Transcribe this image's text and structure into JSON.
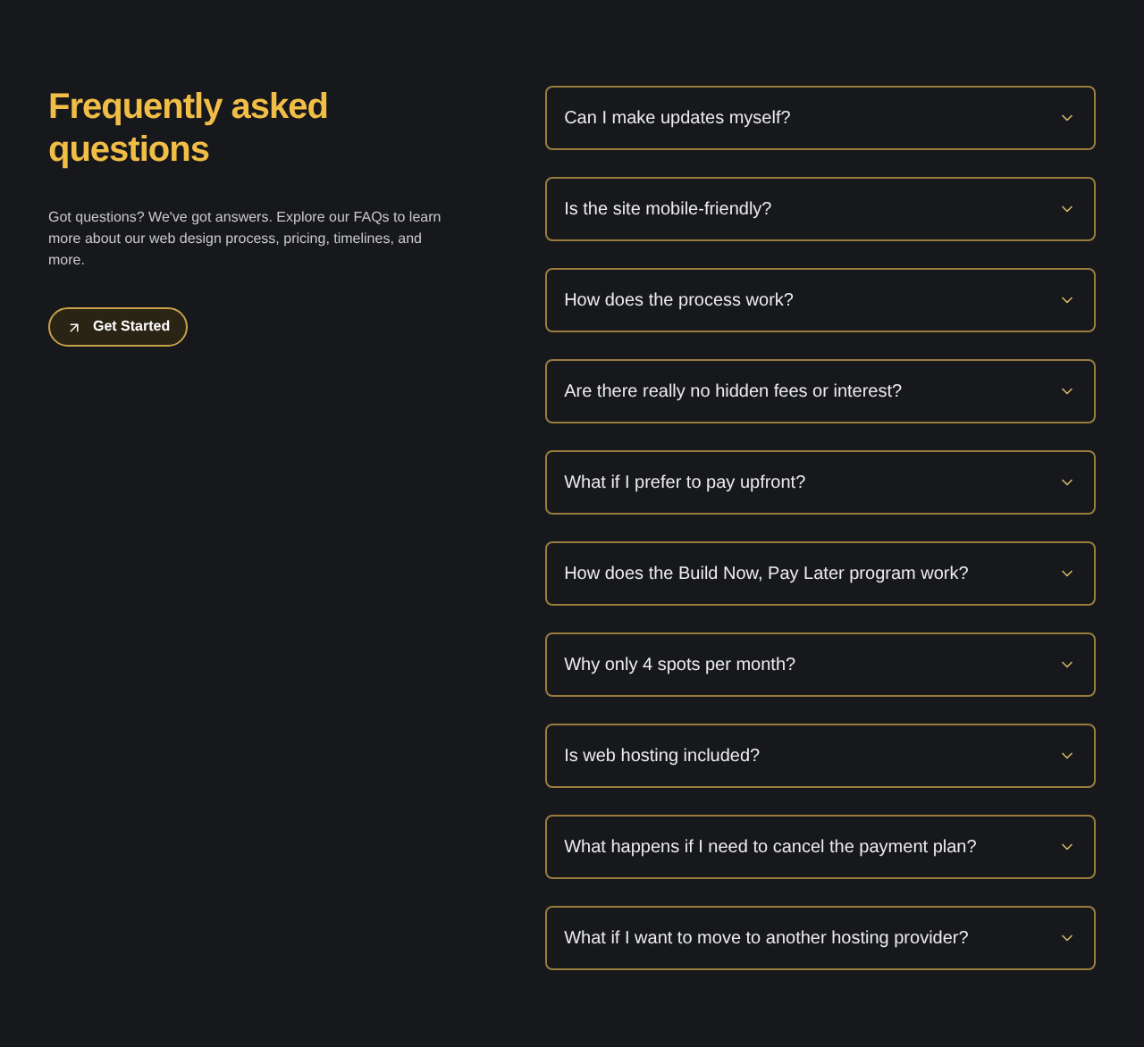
{
  "heading": "Frequently asked questions",
  "intro": "Got questions? We've got answers. Explore our FAQs to learn more about our web design process, pricing, timelines, and more.",
  "cta": {
    "label": "Get Started"
  },
  "faqs": [
    {
      "question": "Can I make updates myself?",
      "expanded": false
    },
    {
      "question": "Is the site mobile-friendly?",
      "expanded": false
    },
    {
      "question": "How does the process work?",
      "expanded": false
    },
    {
      "question": "Are there really no hidden fees or interest?",
      "expanded": false
    },
    {
      "question": "What if I prefer to pay upfront?",
      "expanded": false
    },
    {
      "question": "How does the Build Now, Pay Later program work?",
      "expanded": false
    },
    {
      "question": "Why only 4 spots per month?",
      "expanded": false
    },
    {
      "question": "Is web hosting included?",
      "expanded": false
    },
    {
      "question": "What happens if I need to cancel the payment plan?",
      "expanded": false
    },
    {
      "question": "What if I want to move to another hosting provider?",
      "expanded": false
    }
  ]
}
